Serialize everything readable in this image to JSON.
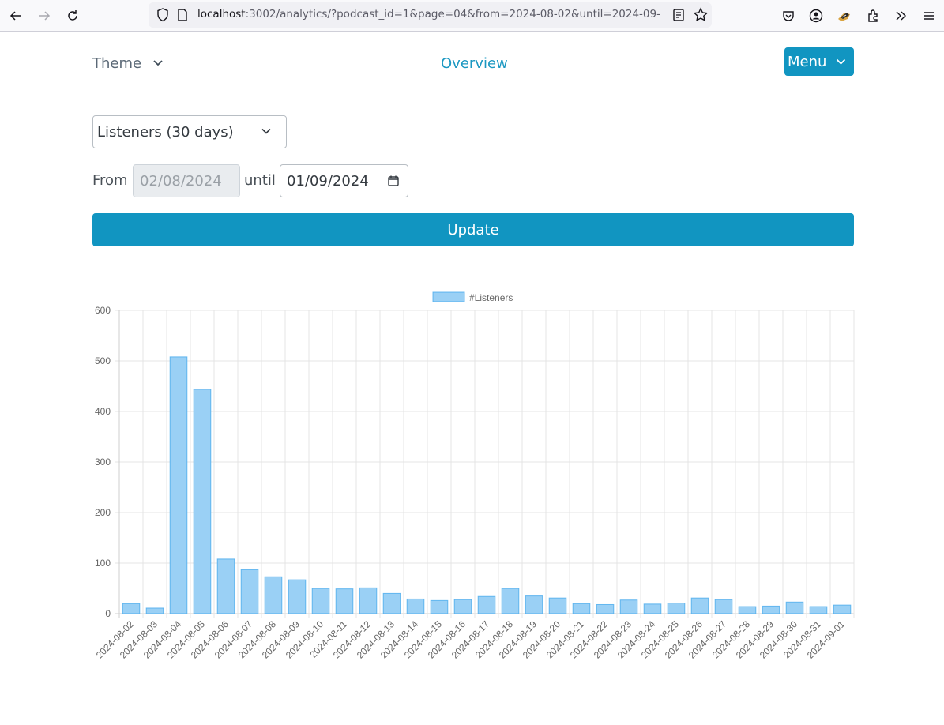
{
  "browser": {
    "url_host": "localhost",
    "url_rest": ":3002/analytics/?podcast_id=1&page=04&from=2024-08-02&until=2024-09-",
    "icons": [
      "back-icon",
      "forward-icon",
      "reload-icon",
      "shield-icon",
      "page-icon",
      "reader-view-icon",
      "bookmark-star-icon",
      "pocket-icon",
      "account-icon",
      "extension-badger-icon",
      "extensions-icon",
      "overflow-icon",
      "hamburger-menu-icon"
    ]
  },
  "nav": {
    "theme_label": "Theme",
    "overview_label": "Overview",
    "menu_label": "Menu"
  },
  "form": {
    "metric_selected": "Listeners (30 days)",
    "from_label": "From",
    "from_value": "02/08/2024",
    "until_label": "until",
    "until_value": "01/09/2024",
    "update_label": "Update"
  },
  "colors": {
    "accent": "#1195c1",
    "bar_fill": "#9ad0f5",
    "bar_border": "#36a2eb"
  },
  "chart_data": {
    "type": "bar",
    "title": "",
    "legend": [
      "#Listeners"
    ],
    "legend_position": "top-center",
    "xlabel": "",
    "ylabel": "",
    "ylim": [
      0,
      600
    ],
    "yticks": [
      0,
      100,
      200,
      300,
      400,
      500,
      600
    ],
    "grid": true,
    "categories": [
      "2024-08-02",
      "2024-08-03",
      "2024-08-04",
      "2024-08-05",
      "2024-08-06",
      "2024-08-07",
      "2024-08-08",
      "2024-08-09",
      "2024-08-10",
      "2024-08-11",
      "2024-08-12",
      "2024-08-13",
      "2024-08-14",
      "2024-08-15",
      "2024-08-16",
      "2024-08-17",
      "2024-08-18",
      "2024-08-19",
      "2024-08-20",
      "2024-08-21",
      "2024-08-22",
      "2024-08-23",
      "2024-08-24",
      "2024-08-25",
      "2024-08-26",
      "2024-08-27",
      "2024-08-28",
      "2024-08-29",
      "2024-08-30",
      "2024-08-31",
      "2024-09-01"
    ],
    "series": [
      {
        "name": "#Listeners",
        "values": [
          20,
          11,
          508,
          444,
          108,
          87,
          73,
          67,
          50,
          49,
          51,
          40,
          29,
          26,
          28,
          34,
          50,
          35,
          31,
          20,
          18,
          27,
          19,
          21,
          31,
          28,
          14,
          15,
          23,
          14,
          17
        ]
      }
    ]
  }
}
